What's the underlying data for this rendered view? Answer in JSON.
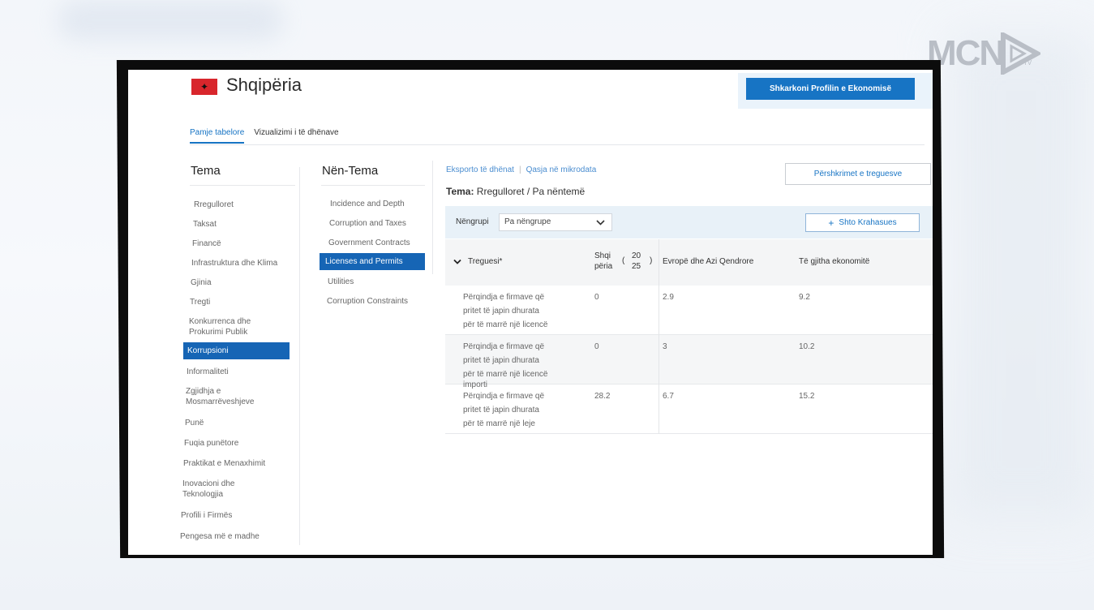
{
  "watermark": {
    "text": "MCN",
    "sub": "TV"
  },
  "header": {
    "country": "Shqipëria",
    "download_button": "Shkarkoni Profilin e Ekonomisë"
  },
  "tabs": [
    {
      "label": "Pamje tabelore",
      "active": true
    },
    {
      "label": "Vizualizimi i të dhënave",
      "active": false
    }
  ],
  "themes": {
    "heading": "Tema",
    "items": [
      "Rregulloret",
      "Taksat",
      "Financë",
      "Infrastruktura dhe Klima",
      "Gjinia",
      "Tregti",
      "Konkurrenca dhe Prokurimi Publik",
      "Korrupsioni",
      "Informaliteti",
      "Zgjidhja e Mosmarrëveshjeve",
      "Punë",
      "Fuqia punëtore",
      "Praktikat e Menaxhimit",
      "Inovacioni dhe Teknologjia",
      "Profili i Firmës",
      "Pengesa më e madhe"
    ],
    "active_index": 7
  },
  "subthemes": {
    "heading": "Nën-Tema",
    "items": [
      "Incidence and Depth",
      "Corruption and Taxes",
      "Government Contracts",
      "Licenses and Permits",
      "Utilities",
      "Corruption Constraints"
    ],
    "active_index": 3
  },
  "main": {
    "export_link": "Eksporto të dhënat",
    "micro_link": "Qasja në mikrodata",
    "tema_label": "Tema:",
    "tema_value": "Rregulloret / Pa nëntemë",
    "describe_button": "Përshkrimet e treguesve",
    "subgroup_label": "Nëngrupi",
    "subgroup_value": "Pa nëngrupe",
    "add_compare_button": "Shto Krahasues",
    "table": {
      "headers": {
        "indicator": "Treguesi*",
        "country_line1": "Shqi",
        "country_line2": "përia",
        "year_line1": "20",
        "year_line2": "25",
        "region": "Evropë dhe Azi Qendrore",
        "all": "Të gjitha ekonomitë"
      },
      "rows": [
        {
          "indicator_lines": [
            "Përqindja e firmave që",
            "pritet të japin dhurata",
            "për të marrë një licencë"
          ],
          "country": "0",
          "region": "2.9",
          "all": "9.2"
        },
        {
          "indicator_lines": [
            "Përqindja e firmave që",
            "pritet të japin dhurata",
            "për të marrë një licencë",
            "importi"
          ],
          "country": "0",
          "region": "3",
          "all": "10.2"
        },
        {
          "indicator_lines": [
            "Përqindja e firmave që",
            "pritet të japin dhurata",
            "për të marrë një leje"
          ],
          "country": "28.2",
          "region": "6.7",
          "all": "15.2"
        }
      ]
    }
  }
}
